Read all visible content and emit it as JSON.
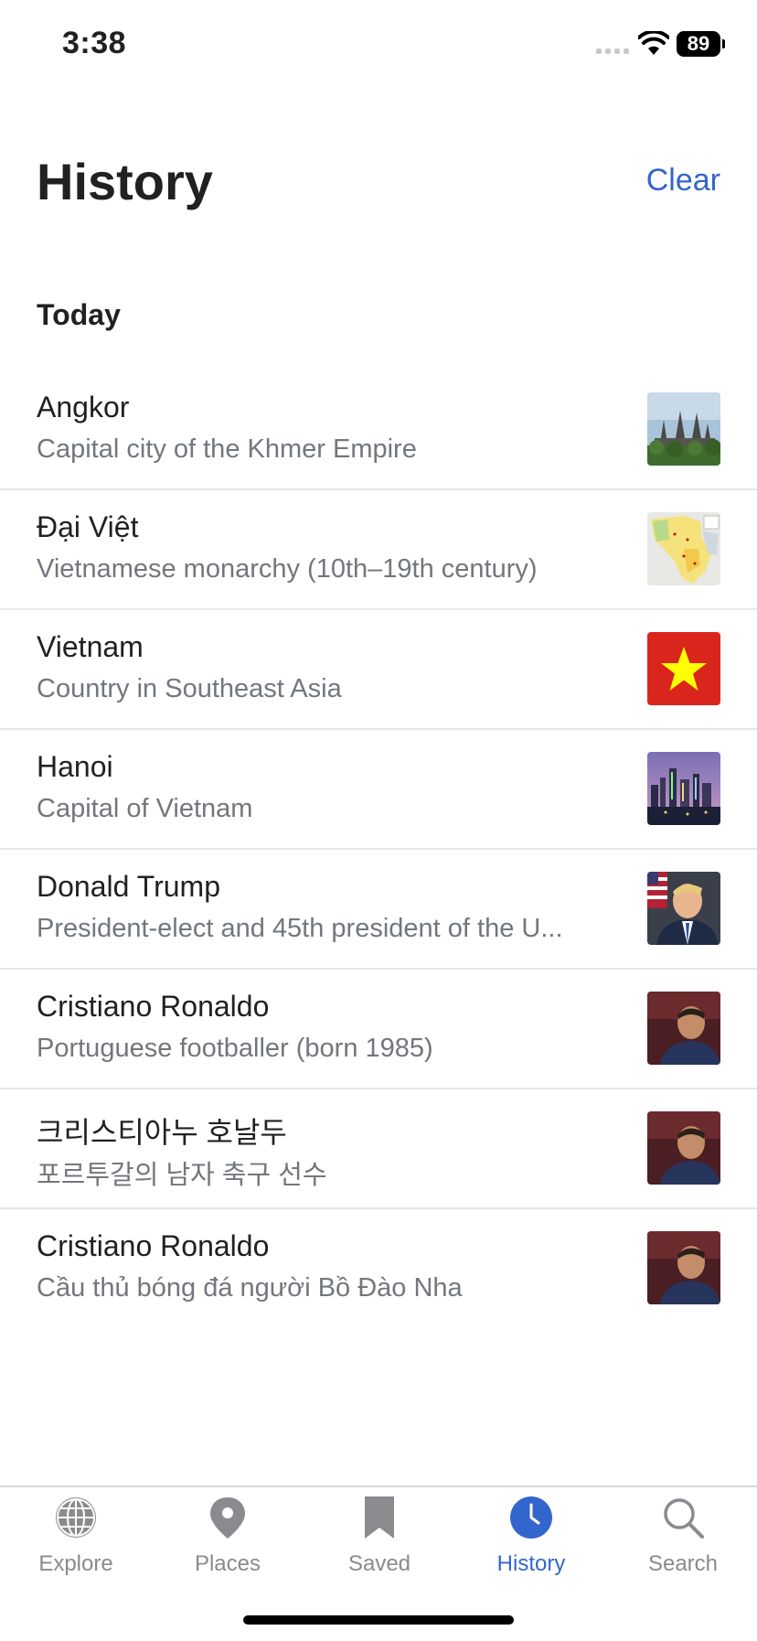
{
  "status_bar": {
    "time": "3:38",
    "battery": "89"
  },
  "header": {
    "title": "History",
    "clear_label": "Clear"
  },
  "section": {
    "title": "Today"
  },
  "history_items": [
    {
      "title": "Angkor",
      "description": "Capital city of the Khmer Empire",
      "thumbnail": "angkor-temple-image"
    },
    {
      "title": "Đại Việt",
      "description": "Vietnamese monarchy (10th–19th century)",
      "thumbnail": "dai-viet-map-image"
    },
    {
      "title": "Vietnam",
      "description": "Country in Southeast Asia",
      "thumbnail": "vietnam-flag-image"
    },
    {
      "title": "Hanoi",
      "description": "Capital of Vietnam",
      "thumbnail": "hanoi-skyline-image"
    },
    {
      "title": "Donald Trump",
      "description": "President-elect and 45th president of the U...",
      "thumbnail": "donald-trump-portrait-image"
    },
    {
      "title": "Cristiano Ronaldo",
      "description": "Portuguese footballer (born 1985)",
      "thumbnail": "cristiano-ronaldo-portrait-image"
    },
    {
      "title": "크리스티아누 호날두",
      "description": "포르투갈의 남자 축구 선수",
      "thumbnail": "cristiano-ronaldo-portrait-image"
    },
    {
      "title": "Cristiano Ronaldo",
      "description": "Cầu thủ bóng đá người Bồ Đào Nha",
      "thumbnail": "cristiano-ronaldo-portrait-image"
    }
  ],
  "tab_bar": {
    "tabs": [
      {
        "label": "Explore",
        "icon": "globe-icon"
      },
      {
        "label": "Places",
        "icon": "map-pin-icon"
      },
      {
        "label": "Saved",
        "icon": "bookmark-icon"
      },
      {
        "label": "History",
        "icon": "clock-icon"
      },
      {
        "label": "Search",
        "icon": "search-icon"
      }
    ],
    "active_tab": "History"
  },
  "colors": {
    "accent": "#3366cc",
    "text": "#202122",
    "secondary_text": "#72777d",
    "flag_red": "#da251d",
    "flag_yellow": "#ffff00"
  }
}
